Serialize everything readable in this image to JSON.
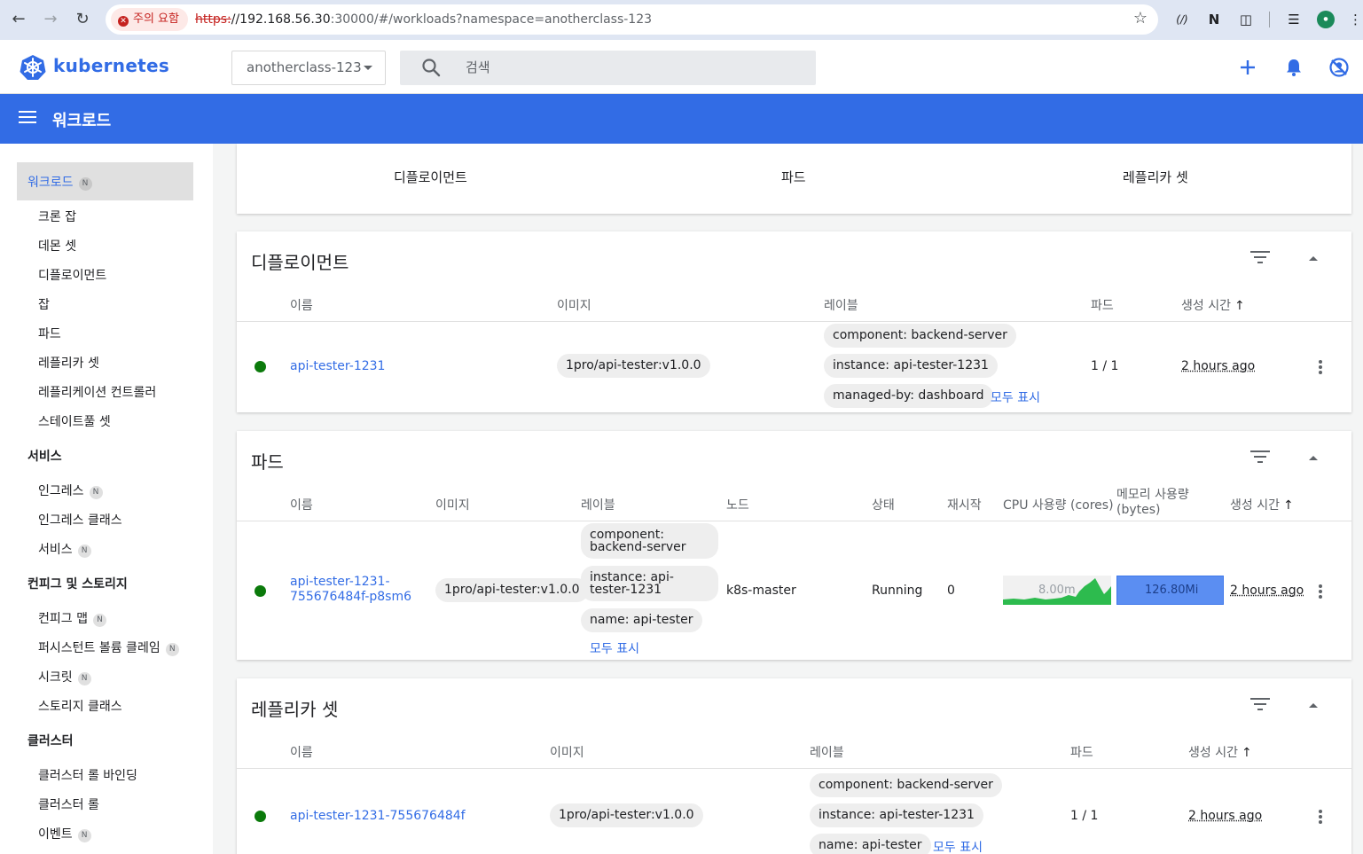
{
  "browser": {
    "warning_label": "주의 요함",
    "url_scheme": "https:",
    "url_host": "//192.168.56.30",
    "url_rest": ":30000/#/workloads?namespace=anotherclass-123"
  },
  "header": {
    "brand": "kubernetes",
    "namespace": "anotherclass-123",
    "search_placeholder": "검색"
  },
  "toolbar": {
    "title": "워크로드"
  },
  "sidebar": {
    "active": {
      "label": "워크로드",
      "badge": "N"
    },
    "workload_items": [
      "크론 잡",
      "데몬 셋",
      "디플로이먼트",
      "잡",
      "파드",
      "레플리카 셋",
      "레플리케이션 컨트롤러",
      "스테이트풀 셋"
    ],
    "service_head": "서비스",
    "service_items": [
      {
        "label": "인그레스",
        "badge": "N"
      },
      {
        "label": "인그레스 클래스",
        "badge": ""
      },
      {
        "label": "서비스",
        "badge": "N"
      }
    ],
    "config_head": "컨피그 및 스토리지",
    "config_items": [
      {
        "label": "컨피그 맵",
        "badge": "N"
      },
      {
        "label": "퍼시스턴트 볼륨 클레임",
        "badge": "N"
      },
      {
        "label": "시크릿",
        "badge": "N"
      },
      {
        "label": "스토리지 클래스",
        "badge": ""
      }
    ],
    "cluster_head": "클러스터",
    "cluster_items": [
      {
        "label": "클러스터 롤 바인딩",
        "badge": ""
      },
      {
        "label": "클러스터 롤",
        "badge": ""
      },
      {
        "label": "이벤트",
        "badge": "N"
      }
    ]
  },
  "tabs": [
    "디플로이먼트",
    "파드",
    "레플리카 셋"
  ],
  "deployments": {
    "title": "디플로이먼트",
    "columns": [
      "이름",
      "이미지",
      "레이블",
      "파드",
      "생성 시간"
    ],
    "row": {
      "name": "api-tester-1231",
      "image": "1pro/api-tester:v1.0.0",
      "labels": [
        "component: backend-server",
        "instance: api-tester-1231",
        "managed-by: dashboard"
      ],
      "show_all": "모두 표시",
      "pods": "1 / 1",
      "age": "2 hours ago"
    }
  },
  "pods": {
    "title": "파드",
    "columns": [
      "이름",
      "이미지",
      "레이블",
      "노드",
      "상태",
      "재시작",
      "CPU 사용량 (cores)",
      "메모리 사용량",
      "(bytes)",
      "생성 시간"
    ],
    "row": {
      "name_line1": "api-tester-1231-",
      "name_line2": "755676484f-p8sm6",
      "image": "1pro/api-tester:v1.0.0",
      "labels": [
        "component: backend-server",
        "instance: api-tester-1231",
        "name: api-tester"
      ],
      "show_all": "모두 표시",
      "node": "k8s-master",
      "status": "Running",
      "restarts": "0",
      "cpu": "8.00m",
      "memory": "126.80Mi",
      "age": "2 hours ago"
    }
  },
  "replicasets": {
    "title": "레플리카 셋",
    "columns": [
      "이름",
      "이미지",
      "레이블",
      "파드",
      "생성 시간"
    ],
    "row": {
      "name": "api-tester-1231-755676484f",
      "image": "1pro/api-tester:v1.0.0",
      "labels": [
        "component: backend-server",
        "instance: api-tester-1231",
        "name: api-tester"
      ],
      "show_all": "모두 표시",
      "pods": "1 / 1",
      "age": "2 hours ago"
    }
  },
  "colors": {
    "brand": "#326ce5",
    "status_ok": "#0b7a0b",
    "cpu_spark": "#2dbb4e",
    "memory_block": "#5b8ef2"
  }
}
